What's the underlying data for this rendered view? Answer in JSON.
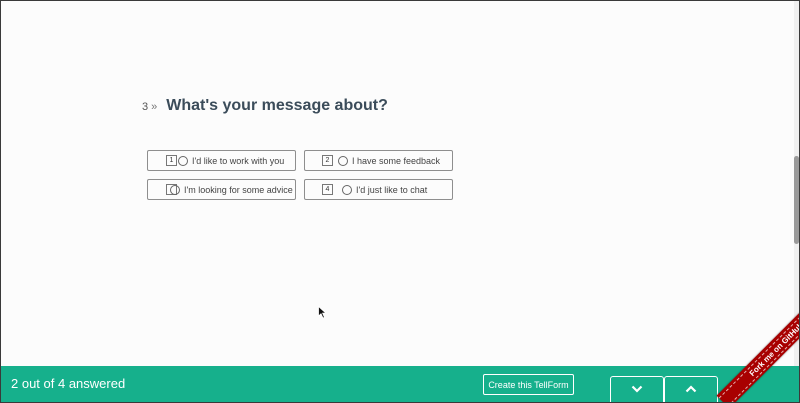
{
  "question": {
    "number": "3",
    "arrow": "»",
    "title": "What's your message about?"
  },
  "choices": [
    {
      "key": "1",
      "label": "I'd like to work with you"
    },
    {
      "key": "2",
      "label": "I have some feedback"
    },
    {
      "key": "3",
      "label": "I'm looking for some advice"
    },
    {
      "key": "4",
      "label": "I'd just like to chat"
    }
  ],
  "footer": {
    "progress": "2 out of 4 answered",
    "answered": 2,
    "total": 4,
    "create_label": "Create this TellForm"
  },
  "ribbon": {
    "label": "Fork me on GitHub"
  },
  "colors": {
    "footer_bg": "#16b08c",
    "ribbon_bg": "#a80000",
    "title": "#3b4c5a"
  }
}
